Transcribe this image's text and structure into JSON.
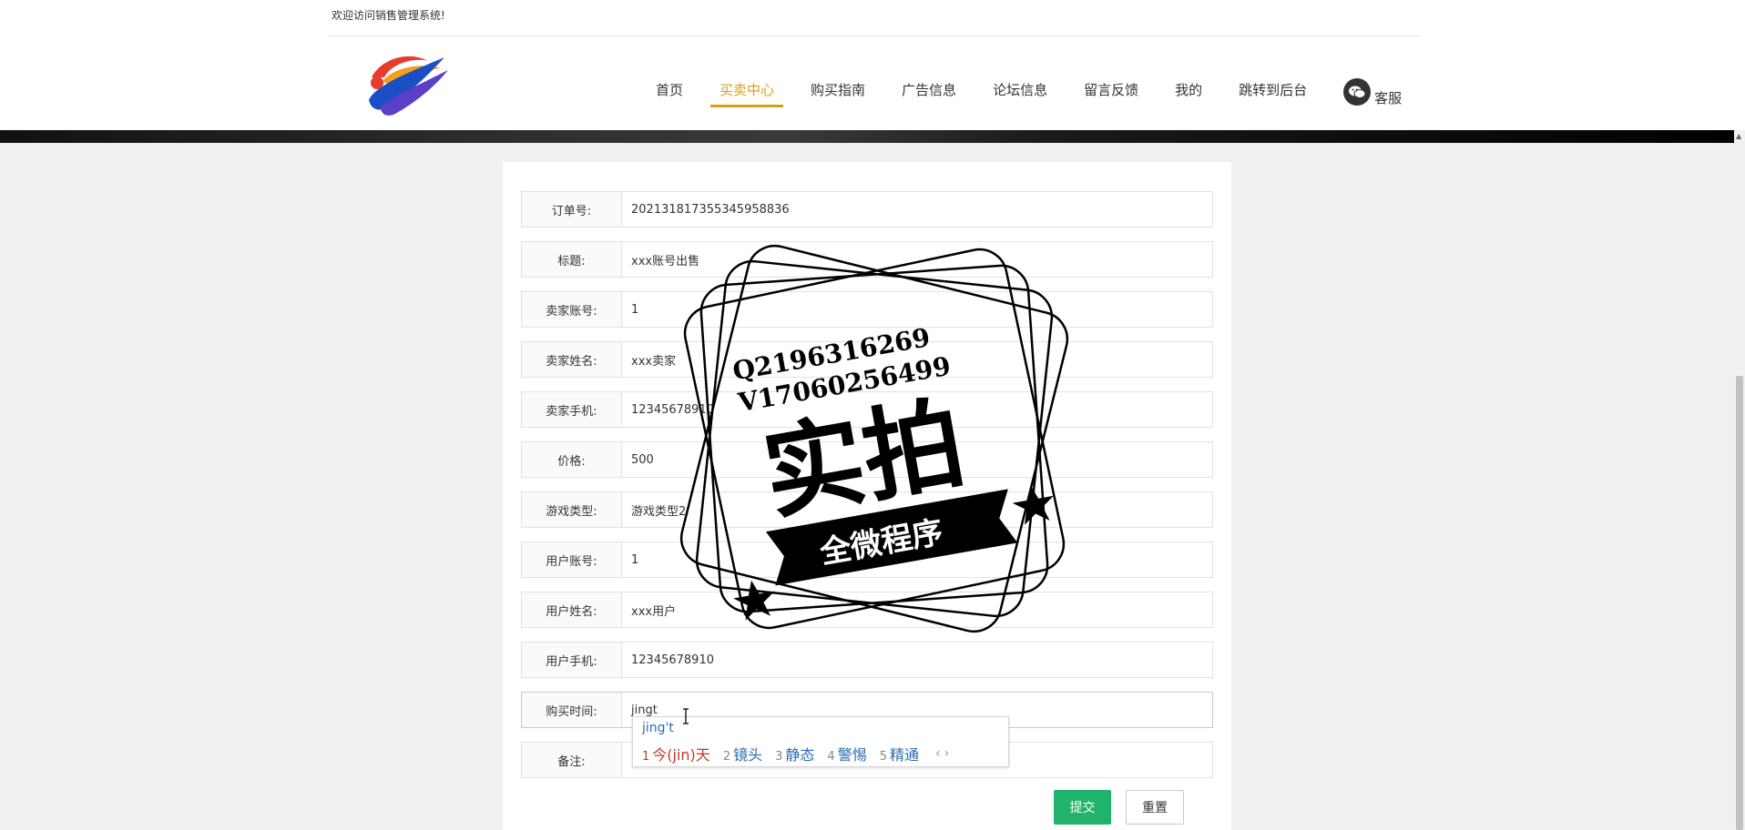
{
  "header": {
    "welcome": "欢迎访问销售管理系统!",
    "nav": [
      "首页",
      "买卖中心",
      "购买指南",
      "广告信息",
      "论坛信息",
      "留言反馈",
      "我的",
      "跳转到后台"
    ],
    "active_index": 1,
    "service_label": "客服",
    "accent_color": "#d4a017"
  },
  "form": {
    "fields": [
      {
        "label": "订单号:",
        "value": "202131817355345958836"
      },
      {
        "label": "标题:",
        "value": "xxx账号出售"
      },
      {
        "label": "卖家账号:",
        "value": "1"
      },
      {
        "label": "卖家姓名:",
        "value": "xxx卖家"
      },
      {
        "label": "卖家手机:",
        "value": "12345678910"
      },
      {
        "label": "价格:",
        "value": "500"
      },
      {
        "label": "游戏类型:",
        "value": "游戏类型2"
      },
      {
        "label": "用户账号:",
        "value": "1"
      },
      {
        "label": "用户姓名:",
        "value": "xxx用户"
      },
      {
        "label": "用户手机:",
        "value": "12345678910"
      },
      {
        "label": "购买时间:",
        "value": "jingt"
      },
      {
        "label": "备注:",
        "value": ""
      }
    ],
    "submit_label": "提交",
    "reset_label": "重置",
    "submit_color": "#21b36a"
  },
  "ime": {
    "composition": "jing't",
    "candidates": [
      {
        "num": "1",
        "text": "今(jin)天"
      },
      {
        "num": "2",
        "text": "镜头"
      },
      {
        "num": "3",
        "text": "静态"
      },
      {
        "num": "4",
        "text": "警惕"
      },
      {
        "num": "5",
        "text": "精通"
      }
    ],
    "prev": "‹",
    "next": "›"
  },
  "watermark": {
    "line1": "Q2196316269",
    "line2": "V17060256499",
    "main": "实拍",
    "ribbon": "全微程序"
  }
}
